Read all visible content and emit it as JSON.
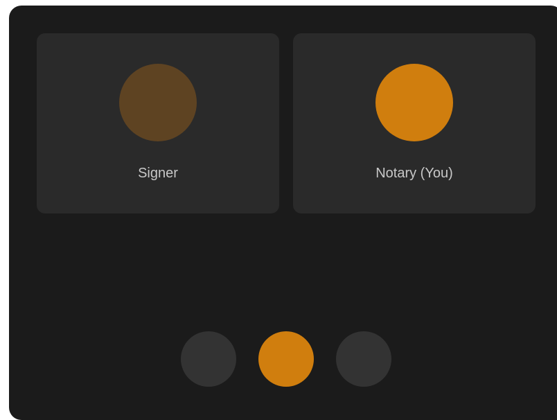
{
  "colors": {
    "background": "#1b1b1b",
    "tile": "#2a2a2a",
    "signer_avatar": "#5e4322",
    "notary_avatar": "#d07e0e",
    "control_default": "#333333",
    "control_active": "#d07e0e",
    "label_text": "#c8c8c8"
  },
  "participants": [
    {
      "label": "Signer",
      "avatar_color": "#5e4322"
    },
    {
      "label": "Notary (You)",
      "avatar_color": "#d07e0e"
    }
  ],
  "controls": [
    {
      "name": "control-button-left",
      "color": "#333333",
      "active": false
    },
    {
      "name": "control-button-center",
      "color": "#d07e0e",
      "active": true
    },
    {
      "name": "control-button-right",
      "color": "#333333",
      "active": false
    }
  ]
}
